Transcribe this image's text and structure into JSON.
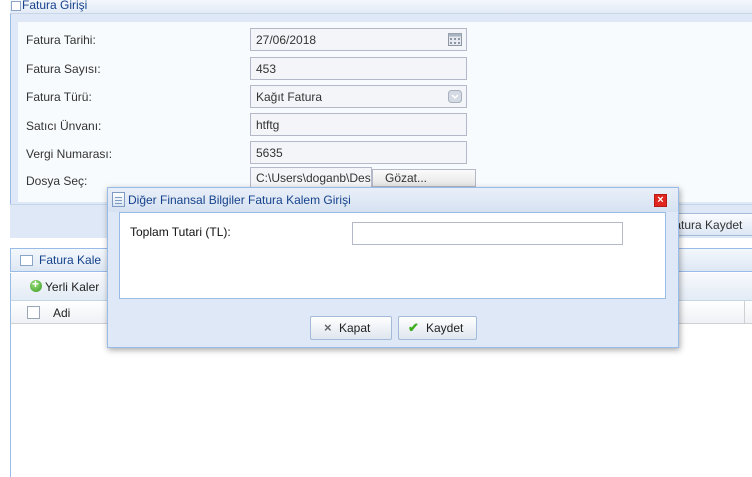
{
  "panel": {
    "title": "Fatura Girişi"
  },
  "form": {
    "fields": [
      {
        "label": "Fatura Tarihi:",
        "value": "27/06/2018",
        "icon": "calendar-icon"
      },
      {
        "label": "Fatura Sayısı:",
        "value": "453"
      },
      {
        "label": "Fatura Türü:",
        "value": "Kağıt Fatura",
        "icon": "chevron-down-icon"
      },
      {
        "label": "Satıcı Ünvanı:",
        "value": "htftg"
      },
      {
        "label": "Vergi Numarası:",
        "value": "5635"
      },
      {
        "label": "Dosya Seç:",
        "value": "C:\\Users\\doganb\\Desktop",
        "button": "Gözat..."
      }
    ],
    "save_label": "Fatura Kaydet"
  },
  "grid": {
    "title": "Fatura Kale",
    "add_label": "Yerli Kaler",
    "column": "Adi"
  },
  "modal": {
    "title": "Diğer Finansal Bilgiler Fatura Kalem Girişi",
    "close_symbol": "×",
    "field_label": "Toplam Tutari (TL):",
    "field_value": "",
    "cancel_label": "Kapat",
    "cancel_glyph": "×",
    "save_label": "Kaydet",
    "save_glyph": "✔"
  },
  "colors": {
    "title_text": "#15428b",
    "panel_bg": "#dfe8f6",
    "close_red": "#e0261f",
    "check_green": "#3cae1f"
  }
}
